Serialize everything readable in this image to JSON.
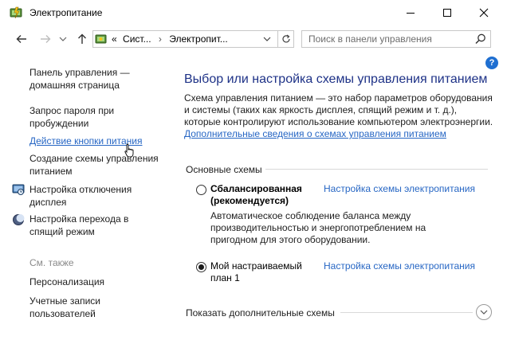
{
  "window": {
    "title": "Электропитание",
    "colors": {
      "accent_link": "#2666c4",
      "title_blue": "#1e3287"
    }
  },
  "toolbar": {
    "address_prefix": "«",
    "breadcrumb": [
      "Сист...",
      "Электропит..."
    ],
    "search_placeholder": "Поиск в панели управления"
  },
  "sidebar": {
    "home": "Панель управления —\nдомашняя страница",
    "items": [
      {
        "label": "Запрос пароля при\nпробуждении",
        "icon": null
      },
      {
        "label": "Действие кнопки питания",
        "icon": null
      },
      {
        "label": "Создание схемы управления\nпитанием",
        "icon": null
      },
      {
        "label": "Настройка отключения\nдисплея",
        "icon": "display-icon"
      },
      {
        "label": "Настройка перехода в\nспящий режим",
        "icon": "moon-icon"
      }
    ],
    "see_also_title": "См. также",
    "see_also": [
      {
        "label": "Персонализация"
      },
      {
        "label": "Учетные записи\nпользователей"
      }
    ]
  },
  "main": {
    "title": "Выбор или настройка схемы управления питанием",
    "description": "Схема управления питанием — это набор параметров оборудования и системы (таких как яркость дисплея, спящий режим и т. д.), которые контролируют использование компьютером электроэнергии.",
    "description_link": "Дополнительные сведения о схемах управления питанием",
    "section_basic": "Основные схемы",
    "plans": [
      {
        "name": "Сбалансированная\n(рекомендуется)",
        "selected": false,
        "link": "Настройка схемы электропитания",
        "description": "Автоматическое соблюдение баланса между производительностью и энергопотреблением на пригодном для этого оборудовании."
      },
      {
        "name": "Мой настраиваемый\nплан 1",
        "selected": true,
        "link": "Настройка схемы электропитания"
      }
    ],
    "show_more": "Показать дополнительные схемы"
  }
}
